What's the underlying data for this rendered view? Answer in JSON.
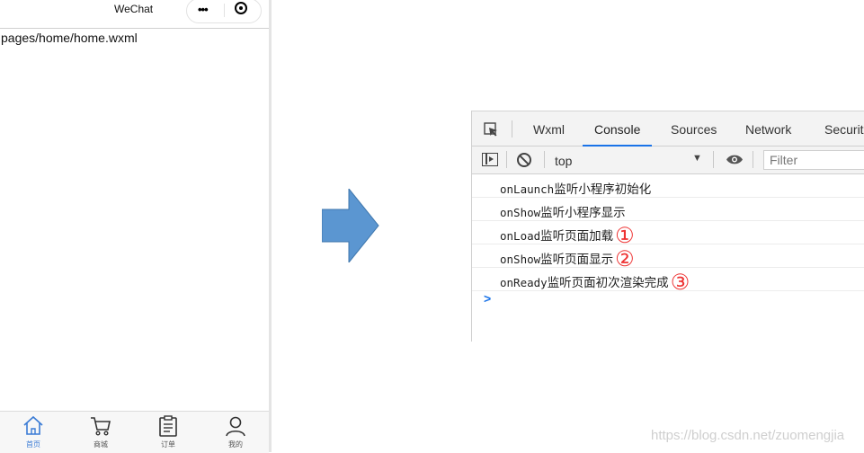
{
  "phone": {
    "nav_title": "WeChat",
    "capsule": {
      "more_icon": "more-dots-icon",
      "close_icon": "target-circle-icon"
    },
    "page_path": "pages/home/home.wxml",
    "tabbar": [
      {
        "label": "首页",
        "icon": "home-icon",
        "active": true
      },
      {
        "label": "商城",
        "icon": "cart-icon",
        "active": false
      },
      {
        "label": "订单",
        "icon": "order-list-icon",
        "active": false
      },
      {
        "label": "我的",
        "icon": "user-icon",
        "active": false
      }
    ]
  },
  "devtools": {
    "tabs": [
      "Wxml",
      "Console",
      "Sources",
      "Network",
      "Securit"
    ],
    "active_tab": "Console",
    "toolbar": {
      "context": "top",
      "filter_placeholder": "Filter"
    },
    "logs": [
      {
        "method": "onLaunch",
        "text": "监听小程序初始化",
        "badge": ""
      },
      {
        "method": "onShow",
        "text": "监听小程序显示",
        "badge": ""
      },
      {
        "method": "onLoad",
        "text": "监听页面加载",
        "badge": "①"
      },
      {
        "method": "onShow",
        "text": "监听页面显示",
        "badge": "②"
      },
      {
        "method": "onReady",
        "text": "监听页面初次渲染完成",
        "badge": "③"
      }
    ],
    "prompt": ">"
  },
  "arrow_color": "#5b96d1",
  "accent_color": "#1a73e8",
  "badge_color": "#e33333",
  "watermark": "https://blog.csdn.net/zuomengjia"
}
